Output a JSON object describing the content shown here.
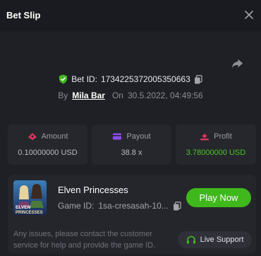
{
  "header": {
    "title": "Bet Slip",
    "close_icon": "close-icon"
  },
  "bet": {
    "id_label": "Bet ID:",
    "id_value": "1734225372005350663",
    "by_label": "By",
    "user": "Mila Bar",
    "on_label": "On",
    "datetime": "30.5.2022, 04:49:56"
  },
  "stats": [
    {
      "label": "Amount",
      "value": "0.10000000 USD",
      "icon": "amount-icon"
    },
    {
      "label": "Payout",
      "value": "38.8 x",
      "icon": "payout-icon"
    },
    {
      "label": "Profit",
      "value": "3.78000000 USD",
      "icon": "profit-icon"
    }
  ],
  "game": {
    "name": "Elven Princesses",
    "id_label": "Game ID:",
    "id_value": "1sa-cresasah-10...",
    "play_label": "Play Now",
    "thumb_text_1": "ELVEN",
    "thumb_text_2": "PRINCESSES"
  },
  "support": {
    "notice": "Any issues, please contact the customer service for help and provide the game ID.",
    "button_label": "Live Support"
  },
  "colors": {
    "accent_green": "#3fb81c",
    "profit_green": "#4ec424",
    "amount_icon": "#e0355c",
    "payout_icon": "#8a4df0",
    "profit_icon": "#e0355c"
  }
}
